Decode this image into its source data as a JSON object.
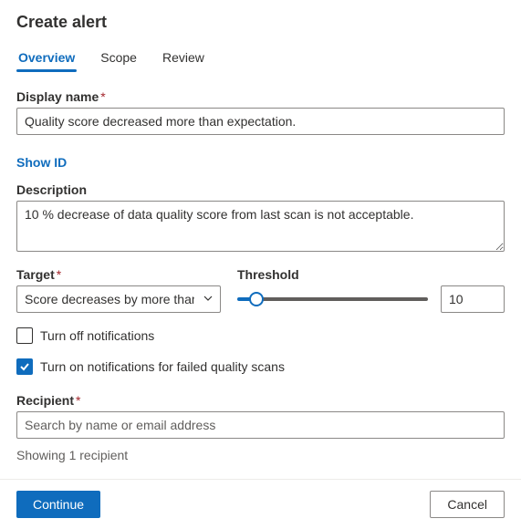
{
  "header": {
    "title": "Create alert"
  },
  "tabs": [
    {
      "label": "Overview",
      "active": true
    },
    {
      "label": "Scope",
      "active": false
    },
    {
      "label": "Review",
      "active": false
    }
  ],
  "displayName": {
    "label": "Display name",
    "required": "*",
    "value": "Quality score decreased more than expectation."
  },
  "showId": {
    "label": "Show ID"
  },
  "description": {
    "label": "Description",
    "value": "10 % decrease of data quality score from last scan is not acceptable."
  },
  "target": {
    "label": "Target",
    "required": "*",
    "selected": "Score decreases by more than"
  },
  "threshold": {
    "label": "Threshold",
    "value": "10"
  },
  "notifications": {
    "off_label": "Turn off notifications",
    "off_checked": false,
    "on_failed_label": "Turn on notifications for failed quality scans",
    "on_failed_checked": true
  },
  "recipient": {
    "label": "Recipient",
    "required": "*",
    "placeholder": "Search by name or email address",
    "meta": "Showing 1 recipient"
  },
  "footer": {
    "continue": "Continue",
    "cancel": "Cancel"
  }
}
